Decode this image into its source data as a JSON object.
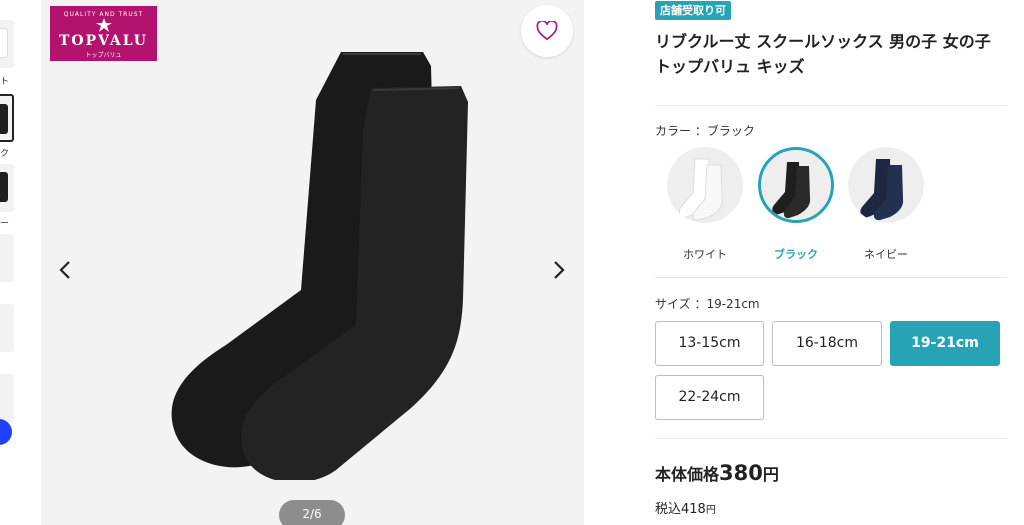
{
  "gallery": {
    "brand_logo": {
      "top_text": "QUALITY AND TRUST",
      "name": "TOPVALU",
      "kana": "トップバリュ"
    },
    "counter": "2/6",
    "thumbnail_labels": [
      "ト",
      "ク",
      "ー"
    ]
  },
  "product": {
    "badge": "店舗受取り可",
    "title_line1": "リブクルー丈 スクールソックス 男の子 女の子",
    "title_line2": "トップバリュ キッズ"
  },
  "color": {
    "label": "カラー ：ブラック",
    "options": [
      {
        "name": "ホワイト",
        "swatch": "#ffffff"
      },
      {
        "name": "ブラック",
        "swatch": "#1f1f1f"
      },
      {
        "name": "ネイビー",
        "swatch": "#1d2740"
      }
    ]
  },
  "size": {
    "label": "サイズ ：19-21cm",
    "options": [
      "13-15cm",
      "16-18cm",
      "19-21cm",
      "22-24cm"
    ]
  },
  "price": {
    "label": "本体価格",
    "value": "380",
    "unit": "円",
    "tax_label": "税込",
    "tax_value": "418",
    "tax_unit": "円"
  },
  "colors": {
    "accent": "#27a3b6",
    "brand": "#b3136e",
    "selected_thumb_border": "#222222"
  }
}
